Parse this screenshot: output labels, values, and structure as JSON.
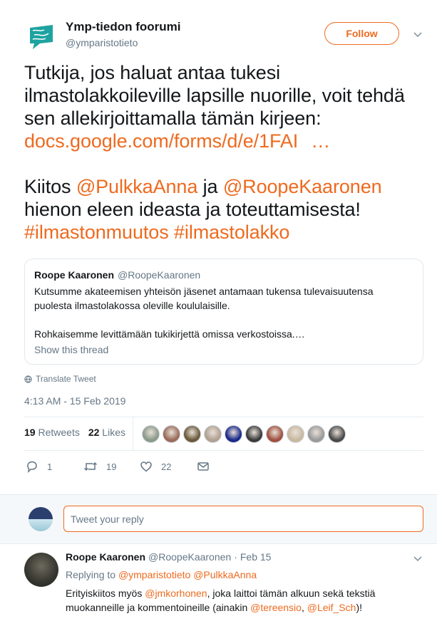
{
  "author": {
    "name": "Ymp-tiedon foorumi",
    "handle": "@ymparistotieto"
  },
  "follow_label": "Follow",
  "tweet": {
    "line1": "Tutkija, jos haluat antaa tukesi",
    "line2": "ilmastolakkoileville lapsille nuorille, voit tehdä",
    "line3": "sen allekirjoittamalla tämän kirjeen:",
    "link": "docs.google.com/forms/d/e/1FAI",
    "link_ellipsis": "…",
    "thanks_pre": "Kiitos ",
    "mention1": "@PulkkaAnna",
    "thanks_mid": " ja ",
    "mention2": "@RoopeKaaronen",
    "line_thanks2": "hienon eleen ideasta ja toteuttamisesta!",
    "hashtag1": "#ilmastonmuutos",
    "hashtag2": "#ilmastolakko"
  },
  "quote": {
    "name": "Roope Kaaronen",
    "handle": "@RoopeKaaronen",
    "line1": "Kutsumme akateemisen yhteisön jäsenet antamaan tukensa tulevaisuutensa",
    "line2": "puolesta ilmastolakossa oleville koululaisille.",
    "line3": "Rohkaisemme levittämään tukikirjettä omissa verkostoissa.…",
    "show_thread": "Show this thread"
  },
  "translate_label": "Translate Tweet",
  "timestamp": "4:13 AM - 15 Feb 2019",
  "stats": {
    "retweets_count": "19",
    "retweets_label": "Retweets",
    "likes_count": "22",
    "likes_label": "Likes"
  },
  "liker_colors": [
    "#8a9a8a",
    "#9a6b5a",
    "#6a5a3a",
    "#b0a090",
    "#1a2a8a",
    "#3a3a3a",
    "#a05040",
    "#c8b8a0",
    "#9a9a9a",
    "#4a4a4a"
  ],
  "actions": {
    "replies": "1",
    "retweets": "19",
    "likes": "22"
  },
  "reply_placeholder": "Tweet your reply",
  "reply": {
    "name": "Roope Kaaronen",
    "handle": "@RoopeKaaronen",
    "sep": "·",
    "date": "Feb 15",
    "replying_to_label": "Replying to",
    "replying_to_1": "@ymparistotieto",
    "replying_to_2": "@PulkkaAnna",
    "text_a": "Erityiskiitos myös ",
    "mention_a": "@jmkorhonen",
    "text_b": ", joka laittoi tämän alkuun sekä tekstiä",
    "text_c": "muokanneille ja kommentoineille (ainakin ",
    "mention_b": "@tereensio",
    "text_d": ", ",
    "mention_c": "@Leif_Sch",
    "text_e": ")!"
  },
  "colors": {
    "accent": "#ee6a1f",
    "muted": "#657786",
    "logo": "#1ea3a0"
  }
}
